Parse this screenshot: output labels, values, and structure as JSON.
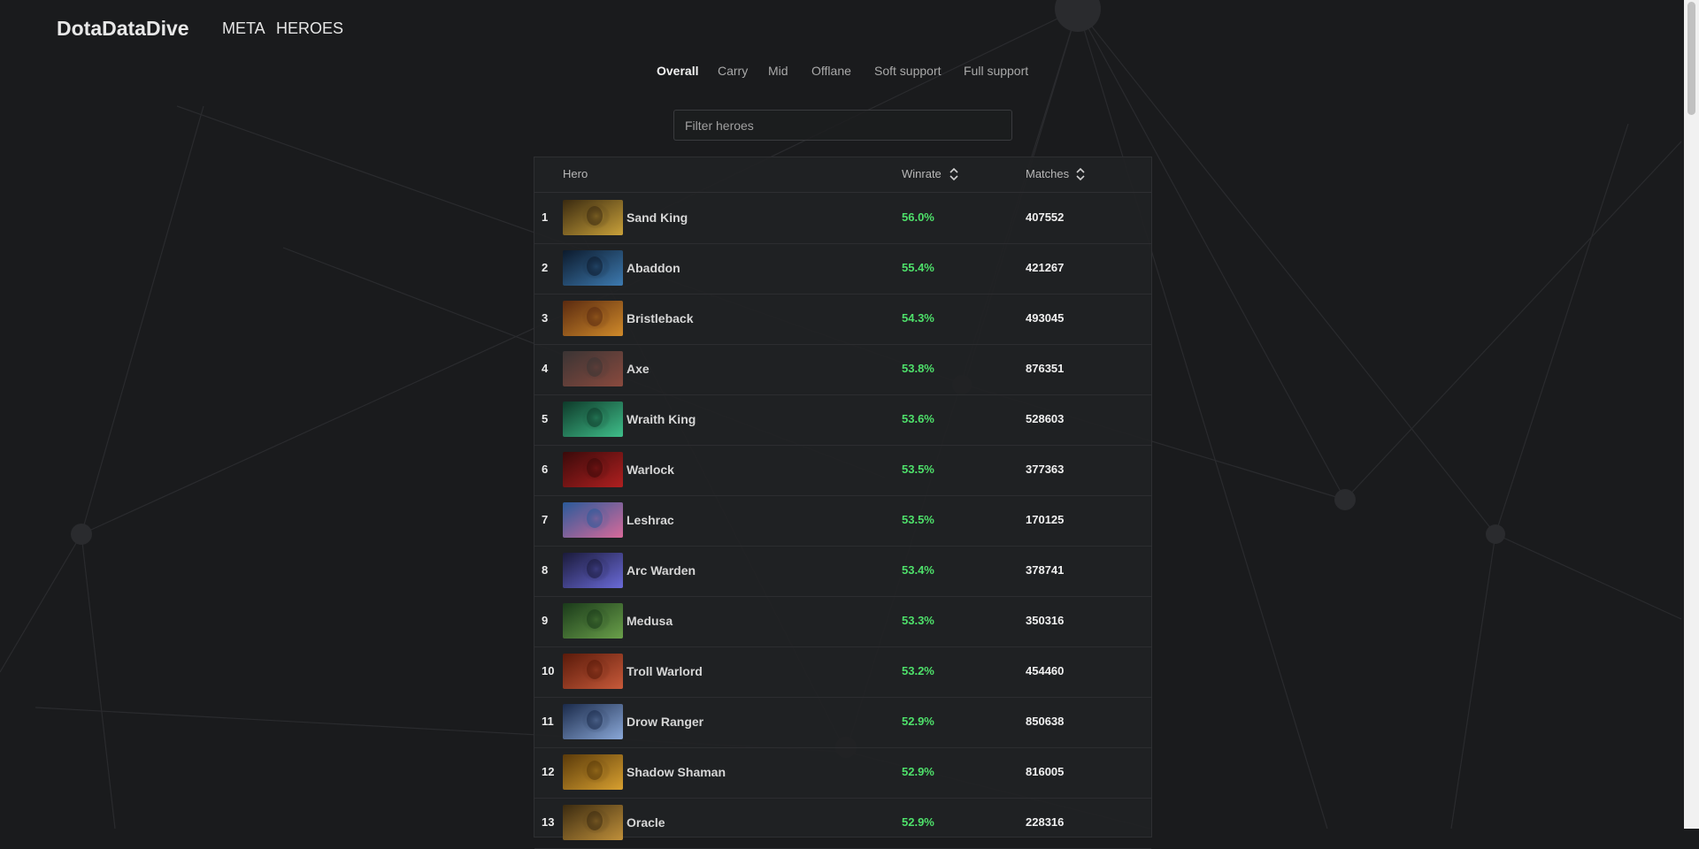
{
  "brand": "DotaDataDive",
  "nav": {
    "meta": "META",
    "heroes": "HEROES"
  },
  "tabs": [
    "Overall",
    "Carry",
    "Mid",
    "Offlane",
    "Soft support",
    "Full support"
  ],
  "active_tab": "Overall",
  "filter": {
    "placeholder": "Filter heroes",
    "value": ""
  },
  "table": {
    "headers": {
      "hero": "Hero",
      "winrate": "Winrate",
      "matches": "Matches"
    },
    "rows": [
      {
        "rank": "1",
        "hero": "Sand King",
        "winrate": "56.0%",
        "matches": "407552",
        "colors": [
          "#3a2a10",
          "#c9a13a"
        ]
      },
      {
        "rank": "2",
        "hero": "Abaddon",
        "winrate": "55.4%",
        "matches": "421267",
        "colors": [
          "#0c1a2c",
          "#3d7ab0"
        ]
      },
      {
        "rank": "3",
        "hero": "Bristleback",
        "winrate": "54.3%",
        "matches": "493045",
        "colors": [
          "#5a2a10",
          "#d08a2a"
        ]
      },
      {
        "rank": "4",
        "hero": "Axe",
        "winrate": "53.8%",
        "matches": "876351",
        "colors": [
          "#3a3434",
          "#8a4a3e"
        ]
      },
      {
        "rank": "5",
        "hero": "Wraith King",
        "winrate": "53.6%",
        "matches": "528603",
        "colors": [
          "#0e3a2a",
          "#3fbf8a"
        ]
      },
      {
        "rank": "6",
        "hero": "Warlock",
        "winrate": "53.5%",
        "matches": "377363",
        "colors": [
          "#3a0a0a",
          "#b02020"
        ]
      },
      {
        "rank": "7",
        "hero": "Leshrac",
        "winrate": "53.5%",
        "matches": "170125",
        "colors": [
          "#2a5a9a",
          "#d86a9a"
        ]
      },
      {
        "rank": "8",
        "hero": "Arc Warden",
        "winrate": "53.4%",
        "matches": "378741",
        "colors": [
          "#1a1a3a",
          "#6a6ad8"
        ]
      },
      {
        "rank": "9",
        "hero": "Medusa",
        "winrate": "53.3%",
        "matches": "350316",
        "colors": [
          "#1a3a1a",
          "#6aa04a"
        ]
      },
      {
        "rank": "10",
        "hero": "Troll Warlord",
        "winrate": "53.2%",
        "matches": "454460",
        "colors": [
          "#5a1a0a",
          "#c85a3a"
        ]
      },
      {
        "rank": "11",
        "hero": "Drow Ranger",
        "winrate": "52.9%",
        "matches": "850638",
        "colors": [
          "#1a2a4a",
          "#8aa8d8"
        ]
      },
      {
        "rank": "12",
        "hero": "Shadow Shaman",
        "winrate": "52.9%",
        "matches": "816005",
        "colors": [
          "#5a3a0a",
          "#d8a030"
        ]
      },
      {
        "rank": "13",
        "hero": "Oracle",
        "winrate": "52.9%",
        "matches": "228316",
        "colors": [
          "#3a2a10",
          "#c0903a"
        ]
      }
    ]
  },
  "colors": {
    "winrate": "#4ee06a",
    "background": "#1a1b1d"
  }
}
